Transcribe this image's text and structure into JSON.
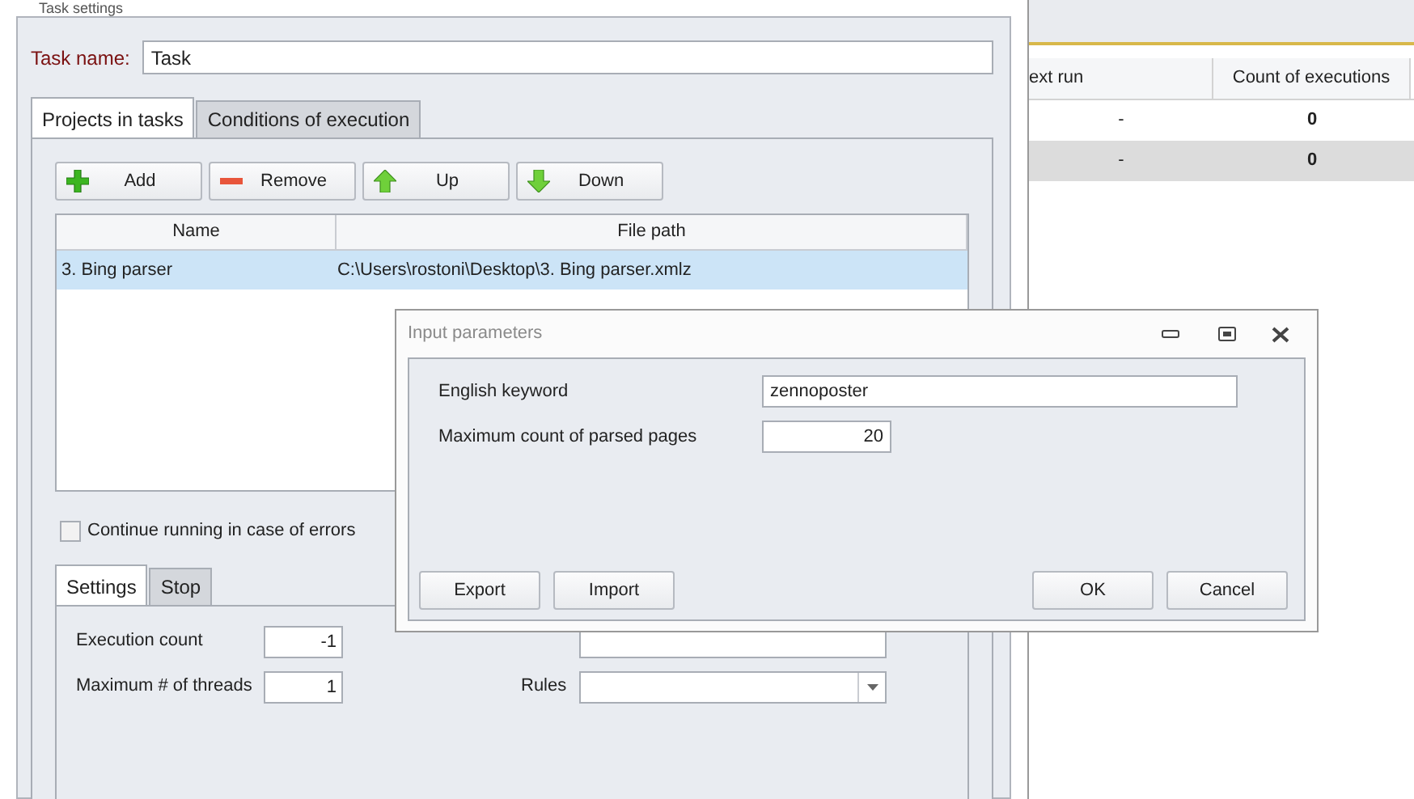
{
  "background_grid": {
    "columns": [
      "ext run",
      "Count of executions"
    ],
    "rows": [
      {
        "cells": [
          "-",
          "0"
        ],
        "selected": false
      },
      {
        "cells": [
          "-",
          "0"
        ],
        "selected": true
      }
    ]
  },
  "window": {
    "title": "Task settings",
    "task_name_label": "Task name:",
    "task_name": "Task",
    "tabs": [
      {
        "label": "Projects in tasks",
        "selected": true
      },
      {
        "label": "Conditions of execution",
        "selected": false
      }
    ],
    "toolbar": [
      {
        "label": "Add",
        "kind": "add"
      },
      {
        "label": "Remove",
        "kind": "remove"
      },
      {
        "label": "Up",
        "kind": "up"
      },
      {
        "label": "Down",
        "kind": "down"
      }
    ],
    "table": {
      "columns": [
        "Name",
        "File path"
      ],
      "rows": [
        {
          "cells": [
            "3. Bing parser",
            "C:\\Users\\rostoni\\Desktop\\3. Bing parser.xmlz"
          ],
          "selected": true
        }
      ]
    },
    "continue_on_errors": {
      "label": "Continue running in case of errors",
      "checked": false
    },
    "bottom_tabs": [
      {
        "label": "Settings",
        "selected": true
      },
      {
        "label": "Stop",
        "selected": false
      }
    ],
    "execution_count_label": "Execution count",
    "execution_count": "-1",
    "max_threads_label": "Maximum # of threads",
    "max_threads": "1",
    "rules_label": "Rules"
  },
  "dialog": {
    "title": "Input parameters",
    "fields": [
      {
        "label": "English keyword",
        "value": "zennoposter",
        "kind": "wide"
      },
      {
        "label": "Maximum count of parsed pages",
        "value": "20",
        "kind": "number"
      }
    ],
    "left_buttons": [
      "Export",
      "Import"
    ],
    "right_buttons": [
      "OK",
      "Cancel"
    ]
  }
}
